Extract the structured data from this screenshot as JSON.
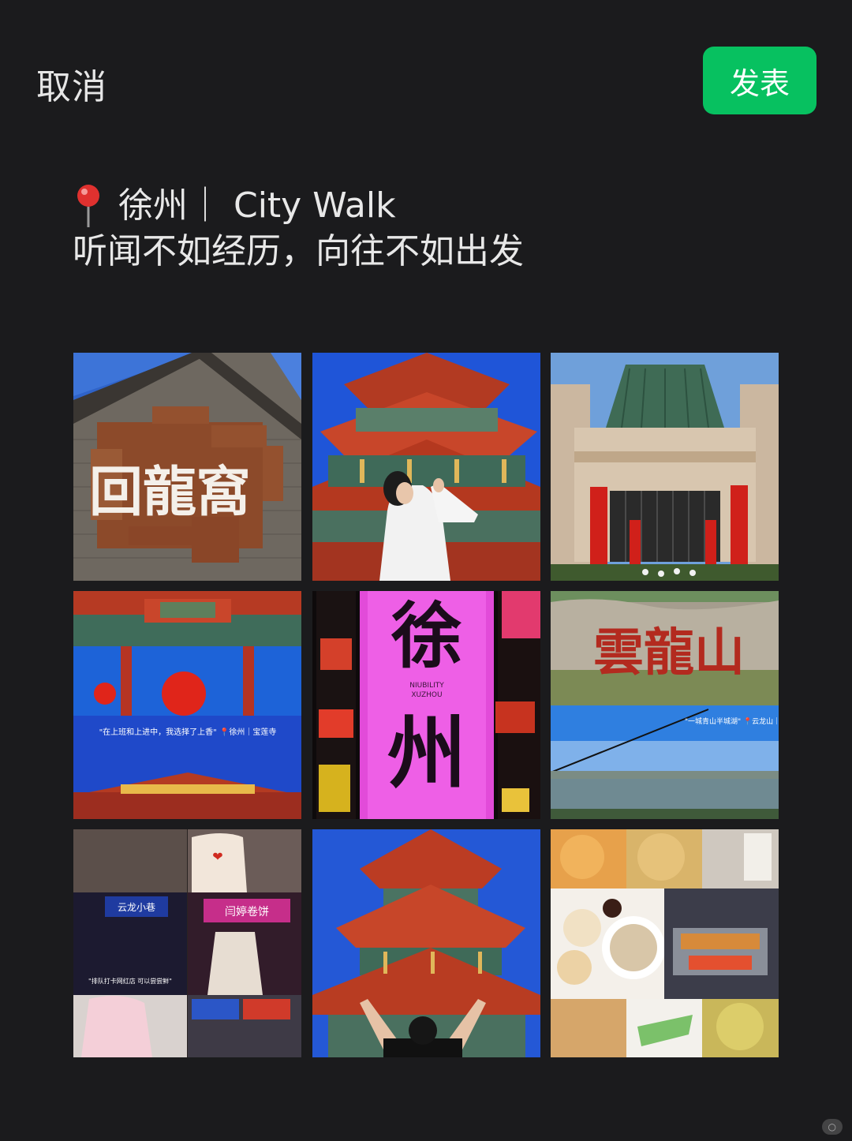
{
  "header": {
    "cancel_label": "取消",
    "publish_label": "发表"
  },
  "post": {
    "location_icon": "location-pin-icon",
    "line1": "徐州｜ City Walk",
    "line2": "听闻不如经历，向往不如出发"
  },
  "photos": {
    "p1_sign": "回龍窩",
    "p3_caption": "\"在上班和上进中，我选择了上香\" 📍徐州｜宝莲寺",
    "p4_big": "徐",
    "p4_big2": "州",
    "p4_small1": "NIUBILITY",
    "p4_small2": "XUZHOU",
    "p5_rock": "雲龍山",
    "p5_caption": "\"一城青山半城湖\" 📍云龙山｜湖",
    "p6_shop1": "云龙小巷",
    "p6_shop2": "闫婷卷饼",
    "p6_caption": "\"排队打卡网红店 可以尝尝鲜\""
  },
  "colors": {
    "background": "#1b1b1d",
    "publish": "#07c160"
  }
}
